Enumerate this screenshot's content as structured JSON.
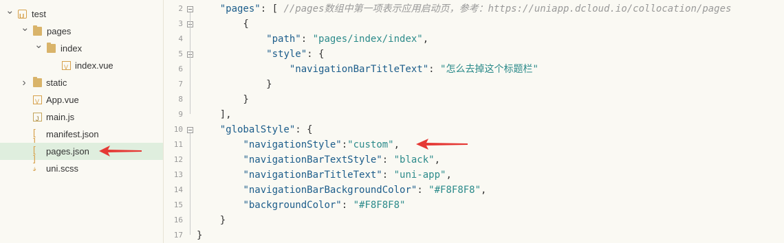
{
  "sidebar": {
    "items": [
      {
        "label": "test",
        "icon": "project-icon",
        "arrow": "chevron-down-icon"
      },
      {
        "label": "pages",
        "icon": "folder-icon",
        "arrow": "chevron-down-icon"
      },
      {
        "label": "index",
        "icon": "folder-icon",
        "arrow": "chevron-down-icon"
      },
      {
        "label": "index.vue",
        "icon": "vue-file-icon"
      },
      {
        "label": "static",
        "icon": "folder-icon",
        "arrow": "chevron-right-icon"
      },
      {
        "label": "App.vue",
        "icon": "vue-file-icon"
      },
      {
        "label": "main.js",
        "icon": "js-file-icon"
      },
      {
        "label": "manifest.json",
        "icon": "json-file-icon"
      },
      {
        "label": "pages.json",
        "icon": "json-file-icon",
        "selected": true
      },
      {
        "label": "uni.scss",
        "icon": "scss-file-icon"
      }
    ],
    "selected_color": "#dfeede"
  },
  "editor": {
    "lines": [
      {
        "n": "2",
        "parts": [
          [
            "p",
            "    "
          ],
          [
            "k",
            "\"pages\""
          ],
          [
            "p",
            ": [ "
          ],
          [
            "c",
            "//pages数组中第一项表示应用启动页，参考：https://uniapp.dcloud.io/collocation/pages"
          ]
        ]
      },
      {
        "n": "3",
        "parts": [
          [
            "p",
            "        {"
          ]
        ]
      },
      {
        "n": "4",
        "parts": [
          [
            "p",
            "            "
          ],
          [
            "k",
            "\"path\""
          ],
          [
            "p",
            ": "
          ],
          [
            "s",
            "\"pages/index/index\""
          ],
          [
            "p",
            ","
          ]
        ]
      },
      {
        "n": "5",
        "parts": [
          [
            "p",
            "            "
          ],
          [
            "k",
            "\"style\""
          ],
          [
            "p",
            ": {"
          ]
        ]
      },
      {
        "n": "6",
        "parts": [
          [
            "p",
            "                "
          ],
          [
            "k",
            "\"navigationBarTitleText\""
          ],
          [
            "p",
            ": "
          ],
          [
            "s",
            "\"怎么去掉这个标题栏\""
          ]
        ]
      },
      {
        "n": "7",
        "parts": [
          [
            "p",
            "            }"
          ]
        ]
      },
      {
        "n": "8",
        "parts": [
          [
            "p",
            "        }"
          ]
        ]
      },
      {
        "n": "9",
        "parts": [
          [
            "p",
            "    ],"
          ]
        ]
      },
      {
        "n": "10",
        "parts": [
          [
            "p",
            "    "
          ],
          [
            "k",
            "\"globalStyle\""
          ],
          [
            "p",
            ": {"
          ]
        ]
      },
      {
        "n": "11",
        "parts": [
          [
            "p",
            "        "
          ],
          [
            "k",
            "\"navigationStyle\""
          ],
          [
            "p",
            ":"
          ],
          [
            "s",
            "\"custom\""
          ],
          [
            "p",
            ","
          ]
        ]
      },
      {
        "n": "12",
        "parts": [
          [
            "p",
            "        "
          ],
          [
            "k",
            "\"navigationBarTextStyle\""
          ],
          [
            "p",
            ": "
          ],
          [
            "s",
            "\"black\""
          ],
          [
            "p",
            ","
          ]
        ]
      },
      {
        "n": "13",
        "parts": [
          [
            "p",
            "        "
          ],
          [
            "k",
            "\"navigationBarTitleText\""
          ],
          [
            "p",
            ": "
          ],
          [
            "s",
            "\"uni-app\""
          ],
          [
            "p",
            ","
          ]
        ]
      },
      {
        "n": "14",
        "parts": [
          [
            "p",
            "        "
          ],
          [
            "k",
            "\"navigationBarBackgroundColor\""
          ],
          [
            "p",
            ": "
          ],
          [
            "s",
            "\"#F8F8F8\""
          ],
          [
            "p",
            ","
          ]
        ]
      },
      {
        "n": "15",
        "parts": [
          [
            "p",
            "        "
          ],
          [
            "k",
            "\"backgroundColor\""
          ],
          [
            "p",
            ": "
          ],
          [
            "s",
            "\"#F8F8F8\""
          ]
        ]
      },
      {
        "n": "16",
        "parts": [
          [
            "p",
            "    }"
          ]
        ]
      },
      {
        "n": "17",
        "parts": [
          [
            "p",
            "}"
          ]
        ]
      }
    ],
    "fold_lines": [
      "2",
      "3",
      "5",
      "10"
    ],
    "colors": {
      "key": "#1b5c8a",
      "string": "#2b8a8a",
      "comment": "#999999",
      "annotation_arrow": "#e53935"
    }
  }
}
